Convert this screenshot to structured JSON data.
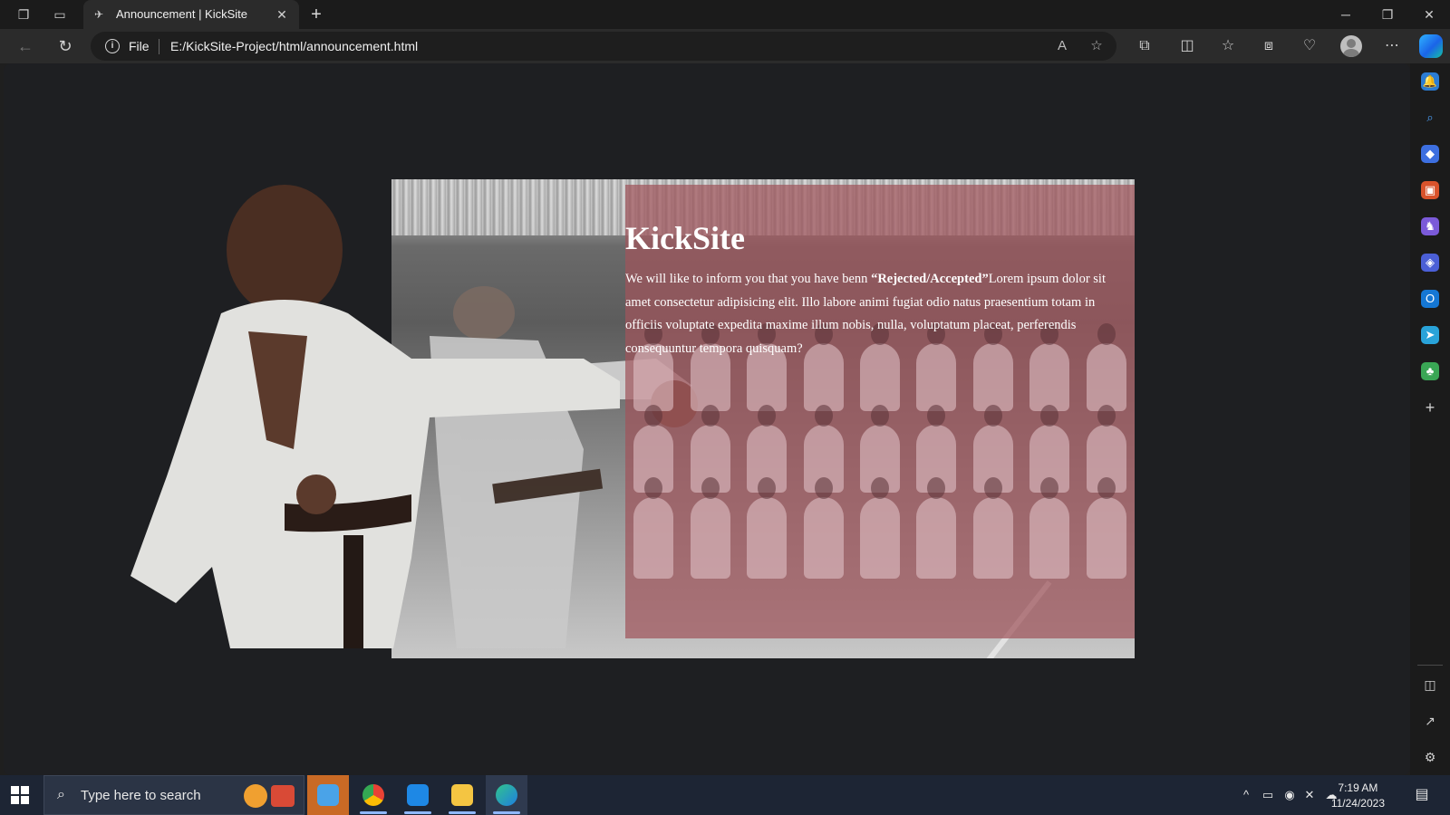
{
  "browser": {
    "tab": {
      "title": "Announcement | KickSite"
    },
    "address": {
      "scheme_label": "File",
      "url": "E:/KickSite-Project/html/announcement.html"
    }
  },
  "page": {
    "hero": {
      "title": "KickSite",
      "text_before": "We will like to inform you that you have benn ",
      "text_bold": "“Rejected/Accepted”",
      "text_after": "Lorem ipsum dolor sit amet consectetur adipisicing elit. Illo labore animi fugiat odio natus praesentium totam in officiis voluptate expedita maxime illum nobis, nulla, voluptatum placeat, perferendis consequuntur tempora quisquam?",
      "overlay_color": "#a0555c"
    }
  },
  "taskbar": {
    "search_placeholder": "Type here to search",
    "clock": {
      "time": "7:19 AM",
      "date": "11/24/2023"
    }
  },
  "icons": {
    "tab_actions": [
      "workspaces-icon",
      "tab-actions-icon"
    ],
    "toolbar": [
      "read-aloud-icon",
      "favorite-star-icon",
      "extensions-icon",
      "split-screen-icon",
      "favorites-icon",
      "collections-icon",
      "browser-essentials-icon",
      "profile-avatar",
      "more-icon",
      "copilot-icon"
    ],
    "sidebar": [
      "notifications-icon",
      "search-icon",
      "shopping-icon",
      "tools-icon",
      "games-icon",
      "microsoft365-icon",
      "outlook-icon",
      "drop-icon",
      "tree-icon",
      "add-icon"
    ]
  }
}
